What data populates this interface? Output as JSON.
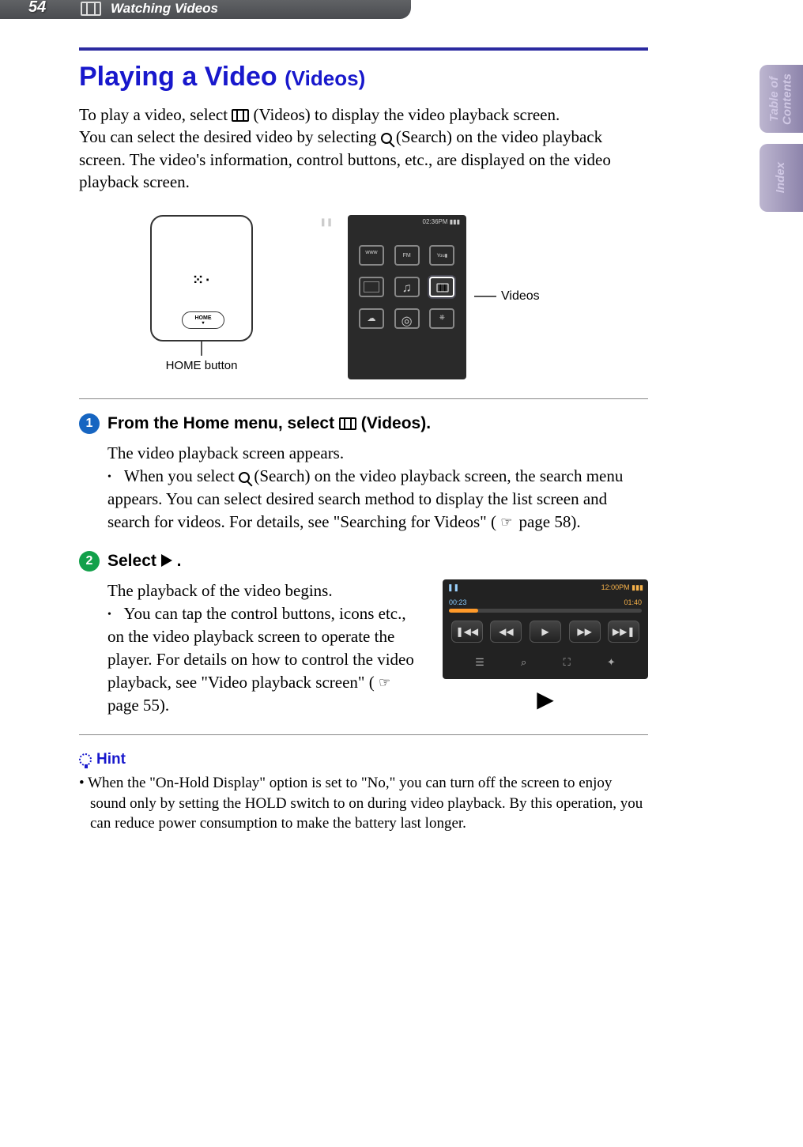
{
  "header": {
    "page_number": "54",
    "section_title": "Watching Videos"
  },
  "sidetabs": {
    "toc": "Table of\nContents",
    "index": "Index"
  },
  "title": {
    "main": "Playing a Video",
    "sub": "(Videos)"
  },
  "intro": {
    "line1a": "To play a video, select ",
    "line1b": " (Videos) to display the video playback screen.",
    "line2a": "You can select the desired video by selecting ",
    "line2b": " (Search) on the video playback screen. The video's information, control buttons, etc., are displayed on the video playback screen."
  },
  "figure": {
    "home_button_label": "HOME",
    "home_caption": "HOME button",
    "menu_status_time": "02:36PM",
    "videos_callout": "Videos"
  },
  "step1": {
    "num": "1",
    "head_a": "From the Home menu, select ",
    "head_b": " (Videos).",
    "body_intro": "The video playback screen appears.",
    "bullet_a": "When you select ",
    "bullet_b": " (Search) on the video playback screen, the search menu appears. You can select desired search method to display the list screen and search for videos. For details, see \"Searching for Videos\" (",
    "bullet_c": " page 58)."
  },
  "step2": {
    "num": "2",
    "head_a": "Select ",
    "head_b": ".",
    "body_intro": "The playback of the video begins.",
    "bullet_a": "You can tap the control buttons, icons etc., on the video playback screen to operate the player. For details on how to control the video playback, see \"Video playback screen\" (",
    "bullet_b": " page 55).",
    "screen": {
      "status_left_icon": "❚❚",
      "status_time": "12:00PM",
      "time_left": "00:23",
      "time_right": "01:40",
      "btn_prev": "❚◀◀",
      "btn_rw": "◀◀",
      "btn_play": "▶",
      "btn_ff": "▶▶",
      "btn_next": "▶▶❚"
    }
  },
  "hint": {
    "label": "Hint",
    "text": "When the \"On-Hold Display\" option is set to \"No,\" you can turn off the screen to enjoy sound only by setting the HOLD switch to on during video playback. By this operation, you can reduce power consumption to make the battery last longer."
  }
}
